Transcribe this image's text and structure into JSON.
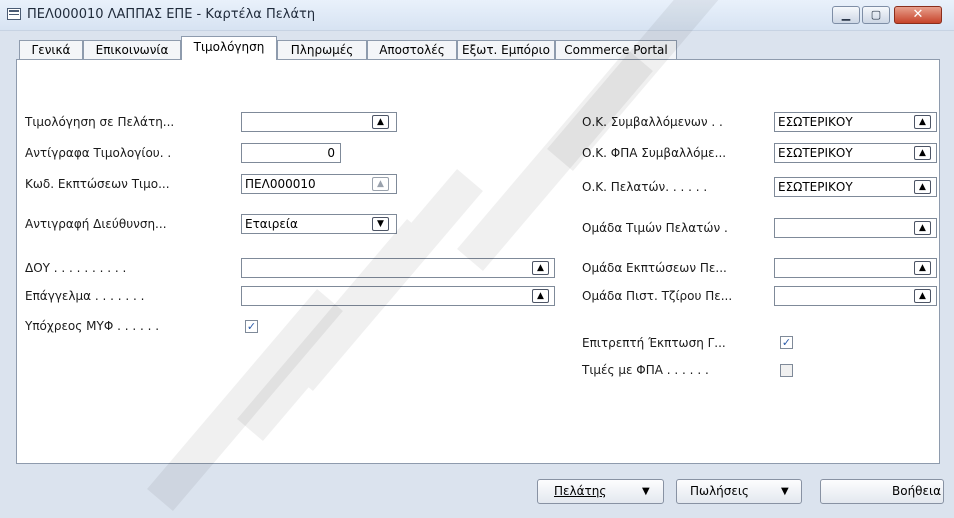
{
  "window": {
    "title": "ΠΕΛ000010 ΛΑΠΠΑΣ ΕΠΕ - Καρτέλα Πελάτη",
    "min_glyph": "▁",
    "max_glyph": "▢",
    "close_glyph": "✕"
  },
  "tabs": [
    "Γενικά",
    "Επικοινωνία",
    "Τιμολόγηση",
    "Πληρωμές",
    "Αποστολές",
    "Εξωτ. Εμπόριο",
    "Commerce Portal"
  ],
  "active_tab": "Τιμολόγηση",
  "left": {
    "invoice_to_label": "Τιμολόγηση σε Πελάτη...",
    "invoice_to_value": "",
    "invoice_copies_label": "Αντίγραφα Τιμολογίου. .",
    "invoice_copies_value": "0",
    "discount_code_label": "Κωδ. Εκπτώσεων Τιμο...",
    "discount_code_value": "ΠΕΛ000010",
    "copy_address_label": "Αντιγραφή Διεύθυνση...",
    "copy_address_value": "Εταιρεία",
    "doy_label": "ΔΟΥ . . . . . . . . . .",
    "doy_value": "",
    "profession_label": "Επάγγελμα . . . . . . .",
    "profession_value": "",
    "myf_label": "Υπόχρεος ΜΥΦ . . . . . .",
    "myf_checked": true
  },
  "right": {
    "contract_group_label": "Ο.Κ. Συμβαλλόμενων . .",
    "contract_group_value": "ΕΣΩΤΕΡΙΚΟΥ",
    "vat_group_label": "Ο.Κ. ΦΠΑ Συμβαλλόμε...",
    "vat_group_value": "ΕΣΩΤΕΡΙΚΟΥ",
    "customer_group_label": "Ο.Κ. Πελατών. . . . . .",
    "customer_group_value": "ΕΣΩΤΕΡΙΚΟΥ",
    "price_group_label": "Ομάδα Τιμών Πελατών  .",
    "price_group_value": "",
    "discount_group_label": "Ομάδα Εκπτώσεων Πε...",
    "discount_group_value": "",
    "credit_group_label": "Ομάδα Πιστ. Τζίρου Πε...",
    "credit_group_value": "",
    "allow_discount_label": "Επιτρεπτή Έκπτωση Γ...",
    "allow_discount_checked": true,
    "prices_vat_label": "Τιμές με ΦΠΑ . . . . . .",
    "prices_vat_checked": false
  },
  "buttons": {
    "customer": "Πελάτης",
    "sales": "Πωλήσεις",
    "help": "Βοήθεια"
  },
  "icons": {
    "lookup": "▲",
    "dropdown": "▼",
    "check": "✓",
    "menu_arrow": "▼"
  }
}
